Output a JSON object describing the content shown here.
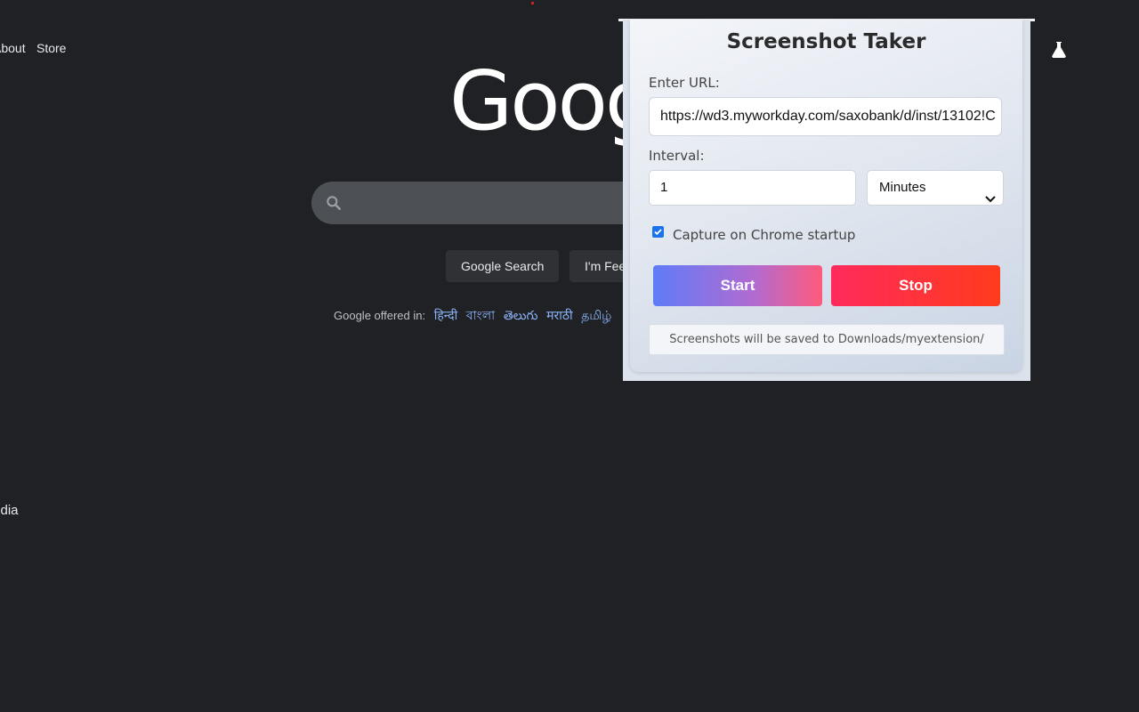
{
  "google": {
    "nav": {
      "about": "About",
      "store": "Store"
    },
    "logo_text": "Google",
    "buttons": {
      "search": "Google Search",
      "lucky": "I'm Feeling Lucky"
    },
    "offered_label": "Google offered in:",
    "languages": [
      "हिन्दी",
      "বাংলা",
      "తెలుగు",
      "मराठी",
      "தமிழ்"
    ],
    "footer_country": "India"
  },
  "extension": {
    "title": "Screenshot Taker",
    "url_label": "Enter URL:",
    "url_value": "https://wd3.myworkday.com/saxobank/d/inst/13102!C",
    "interval_label": "Interval:",
    "interval_value": "1",
    "interval_unit": "Minutes",
    "startup_label": "Capture on Chrome startup",
    "startup_checked": true,
    "start_label": "Start",
    "stop_label": "Stop",
    "save_info": "Screenshots will be saved to Downloads/myextension/"
  },
  "icons": {
    "labs": "flask-icon",
    "search": "search-icon",
    "dropdown": "chevron-down-icon",
    "check": "check-icon"
  },
  "colors": {
    "background": "#202124",
    "link": "#8ab4f8",
    "checkbox": "#1a73e8",
    "start_from": "#5f7cf8",
    "start_to": "#ff5a7c",
    "stop_from": "#ff2a5c",
    "stop_to": "#ff3b1c"
  }
}
